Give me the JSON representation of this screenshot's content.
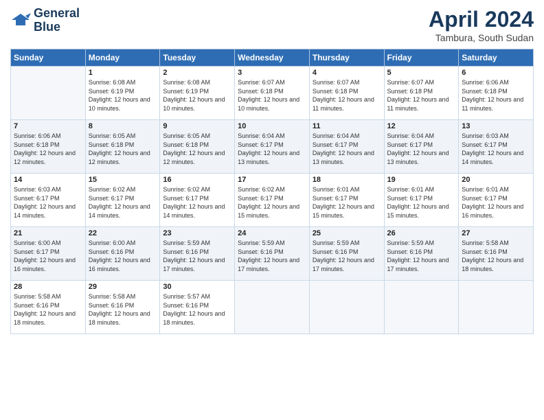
{
  "header": {
    "logo_line1": "General",
    "logo_line2": "Blue",
    "month_title": "April 2024",
    "location": "Tambura, South Sudan"
  },
  "weekdays": [
    "Sunday",
    "Monday",
    "Tuesday",
    "Wednesday",
    "Thursday",
    "Friday",
    "Saturday"
  ],
  "weeks": [
    [
      {
        "day": "",
        "sunrise": "",
        "sunset": "",
        "daylight": ""
      },
      {
        "day": "1",
        "sunrise": "Sunrise: 6:08 AM",
        "sunset": "Sunset: 6:19 PM",
        "daylight": "Daylight: 12 hours and 10 minutes."
      },
      {
        "day": "2",
        "sunrise": "Sunrise: 6:08 AM",
        "sunset": "Sunset: 6:19 PM",
        "daylight": "Daylight: 12 hours and 10 minutes."
      },
      {
        "day": "3",
        "sunrise": "Sunrise: 6:07 AM",
        "sunset": "Sunset: 6:18 PM",
        "daylight": "Daylight: 12 hours and 10 minutes."
      },
      {
        "day": "4",
        "sunrise": "Sunrise: 6:07 AM",
        "sunset": "Sunset: 6:18 PM",
        "daylight": "Daylight: 12 hours and 11 minutes."
      },
      {
        "day": "5",
        "sunrise": "Sunrise: 6:07 AM",
        "sunset": "Sunset: 6:18 PM",
        "daylight": "Daylight: 12 hours and 11 minutes."
      },
      {
        "day": "6",
        "sunrise": "Sunrise: 6:06 AM",
        "sunset": "Sunset: 6:18 PM",
        "daylight": "Daylight: 12 hours and 11 minutes."
      }
    ],
    [
      {
        "day": "7",
        "sunrise": "Sunrise: 6:06 AM",
        "sunset": "Sunset: 6:18 PM",
        "daylight": "Daylight: 12 hours and 12 minutes."
      },
      {
        "day": "8",
        "sunrise": "Sunrise: 6:05 AM",
        "sunset": "Sunset: 6:18 PM",
        "daylight": "Daylight: 12 hours and 12 minutes."
      },
      {
        "day": "9",
        "sunrise": "Sunrise: 6:05 AM",
        "sunset": "Sunset: 6:18 PM",
        "daylight": "Daylight: 12 hours and 12 minutes."
      },
      {
        "day": "10",
        "sunrise": "Sunrise: 6:04 AM",
        "sunset": "Sunset: 6:17 PM",
        "daylight": "Daylight: 12 hours and 13 minutes."
      },
      {
        "day": "11",
        "sunrise": "Sunrise: 6:04 AM",
        "sunset": "Sunset: 6:17 PM",
        "daylight": "Daylight: 12 hours and 13 minutes."
      },
      {
        "day": "12",
        "sunrise": "Sunrise: 6:04 AM",
        "sunset": "Sunset: 6:17 PM",
        "daylight": "Daylight: 12 hours and 13 minutes."
      },
      {
        "day": "13",
        "sunrise": "Sunrise: 6:03 AM",
        "sunset": "Sunset: 6:17 PM",
        "daylight": "Daylight: 12 hours and 14 minutes."
      }
    ],
    [
      {
        "day": "14",
        "sunrise": "Sunrise: 6:03 AM",
        "sunset": "Sunset: 6:17 PM",
        "daylight": "Daylight: 12 hours and 14 minutes."
      },
      {
        "day": "15",
        "sunrise": "Sunrise: 6:02 AM",
        "sunset": "Sunset: 6:17 PM",
        "daylight": "Daylight: 12 hours and 14 minutes."
      },
      {
        "day": "16",
        "sunrise": "Sunrise: 6:02 AM",
        "sunset": "Sunset: 6:17 PM",
        "daylight": "Daylight: 12 hours and 14 minutes."
      },
      {
        "day": "17",
        "sunrise": "Sunrise: 6:02 AM",
        "sunset": "Sunset: 6:17 PM",
        "daylight": "Daylight: 12 hours and 15 minutes."
      },
      {
        "day": "18",
        "sunrise": "Sunrise: 6:01 AM",
        "sunset": "Sunset: 6:17 PM",
        "daylight": "Daylight: 12 hours and 15 minutes."
      },
      {
        "day": "19",
        "sunrise": "Sunrise: 6:01 AM",
        "sunset": "Sunset: 6:17 PM",
        "daylight": "Daylight: 12 hours and 15 minutes."
      },
      {
        "day": "20",
        "sunrise": "Sunrise: 6:01 AM",
        "sunset": "Sunset: 6:17 PM",
        "daylight": "Daylight: 12 hours and 16 minutes."
      }
    ],
    [
      {
        "day": "21",
        "sunrise": "Sunrise: 6:00 AM",
        "sunset": "Sunset: 6:17 PM",
        "daylight": "Daylight: 12 hours and 16 minutes."
      },
      {
        "day": "22",
        "sunrise": "Sunrise: 6:00 AM",
        "sunset": "Sunset: 6:16 PM",
        "daylight": "Daylight: 12 hours and 16 minutes."
      },
      {
        "day": "23",
        "sunrise": "Sunrise: 5:59 AM",
        "sunset": "Sunset: 6:16 PM",
        "daylight": "Daylight: 12 hours and 17 minutes."
      },
      {
        "day": "24",
        "sunrise": "Sunrise: 5:59 AM",
        "sunset": "Sunset: 6:16 PM",
        "daylight": "Daylight: 12 hours and 17 minutes."
      },
      {
        "day": "25",
        "sunrise": "Sunrise: 5:59 AM",
        "sunset": "Sunset: 6:16 PM",
        "daylight": "Daylight: 12 hours and 17 minutes."
      },
      {
        "day": "26",
        "sunrise": "Sunrise: 5:59 AM",
        "sunset": "Sunset: 6:16 PM",
        "daylight": "Daylight: 12 hours and 17 minutes."
      },
      {
        "day": "27",
        "sunrise": "Sunrise: 5:58 AM",
        "sunset": "Sunset: 6:16 PM",
        "daylight": "Daylight: 12 hours and 18 minutes."
      }
    ],
    [
      {
        "day": "28",
        "sunrise": "Sunrise: 5:58 AM",
        "sunset": "Sunset: 6:16 PM",
        "daylight": "Daylight: 12 hours and 18 minutes."
      },
      {
        "day": "29",
        "sunrise": "Sunrise: 5:58 AM",
        "sunset": "Sunset: 6:16 PM",
        "daylight": "Daylight: 12 hours and 18 minutes."
      },
      {
        "day": "30",
        "sunrise": "Sunrise: 5:57 AM",
        "sunset": "Sunset: 6:16 PM",
        "daylight": "Daylight: 12 hours and 18 minutes."
      },
      {
        "day": "",
        "sunrise": "",
        "sunset": "",
        "daylight": ""
      },
      {
        "day": "",
        "sunrise": "",
        "sunset": "",
        "daylight": ""
      },
      {
        "day": "",
        "sunrise": "",
        "sunset": "",
        "daylight": ""
      },
      {
        "day": "",
        "sunrise": "",
        "sunset": "",
        "daylight": ""
      }
    ]
  ]
}
